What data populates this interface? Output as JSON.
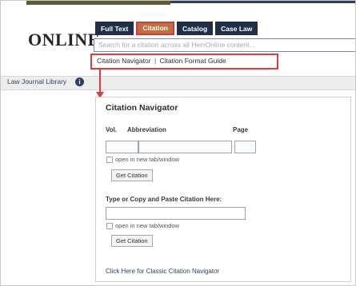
{
  "brand": {
    "logo_text": "ONLINE"
  },
  "tabs": [
    {
      "label": "Full Text",
      "active": false
    },
    {
      "label": "Citation",
      "active": true
    },
    {
      "label": "Catalog",
      "active": false
    },
    {
      "label": "Case Law",
      "active": false
    }
  ],
  "search": {
    "placeholder": "Search for a citation across all HeinOnline content..."
  },
  "sublinks": {
    "citation_navigator": "Citation Navigator",
    "separator": "|",
    "citation_format_guide": "Citation Format Guide"
  },
  "library": {
    "label": "Law Journal Library"
  },
  "citation_navigator": {
    "title": "Citation Navigator",
    "vol_label": "Vol.",
    "abbreviation_label": "Abbreviation",
    "page_label": "Page",
    "open_new_window_label": "open in new tab/window",
    "get_citation_button": "Get Citation",
    "paste_label": "Type or Copy and Paste Citation Here:",
    "open_new_window_label_2": "open in new tab/window",
    "get_citation_button_2": "Get Citation",
    "classic_link": "Click Here for Classic Citation Navigator"
  },
  "colors": {
    "nav_dark": "#202e4a",
    "tab_active": "#c0703f",
    "highlight_red": "#e23b3b"
  }
}
